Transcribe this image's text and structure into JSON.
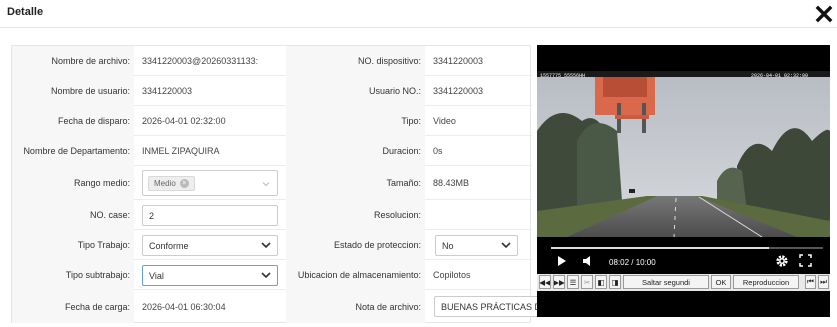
{
  "header": {
    "title": "Detalle"
  },
  "rows": [
    {
      "label1": "Nombre de archivo:",
      "value1": "3341220003@20260331133:",
      "label2": "NO. dispositivo:",
      "value2": "3341220003"
    },
    {
      "label1": "Nombre de usuario:",
      "value1": "3341220003",
      "label2": "Usuario NO.:",
      "value2": "3341220003"
    },
    {
      "label1": "Fecha de disparo:",
      "value1": "2026-04-01 02:32:00",
      "label2": "Tipo:",
      "value2": "Video"
    },
    {
      "label1": "Nombre de Departamento:",
      "value1": "INMEL ZIPAQUIRA",
      "label2": "Duracion:",
      "value2": "0s"
    },
    {
      "label1": "Rango medio:",
      "label2": "Tamaño:",
      "value2": "88.43MB"
    },
    {
      "label1": "NO. case:",
      "label2": "Resolucion:",
      "value2": ""
    },
    {
      "label1": "Tipo Trabajo:",
      "label2": "Estado de proteccion:"
    },
    {
      "label1": "Tipo subtrabajo:",
      "label2": "Ubicacion de almacenamiento:",
      "value2": "Copilotos"
    },
    {
      "label1": "Fecha de carga:",
      "value1": "2026-04-01 06:30:04",
      "label2": "Nota de archivo:"
    }
  ],
  "form": {
    "rango_tag": "Medio",
    "case_no": "2",
    "tipo_trabajo": "Conforme",
    "estado_proteccion": "No",
    "tipo_subtrabajo": "Vial",
    "nota_archivo": "BUENAS PRÁCTICAS DE CONDUCCIÓN - diego ortega"
  },
  "player": {
    "time": "08:02 / 10:00",
    "progress": 0.8,
    "osd_left": "1557775_55556HH",
    "osd_right": "2026-04-01 02:32:00",
    "toolbar": {
      "speed": "Saltar segundi",
      "ok": "OK",
      "play": "Reproduccion"
    }
  },
  "colors": {
    "accent": "#6a9fd8",
    "label_bg": "#f7f7f7",
    "video_bg": "#000000"
  }
}
